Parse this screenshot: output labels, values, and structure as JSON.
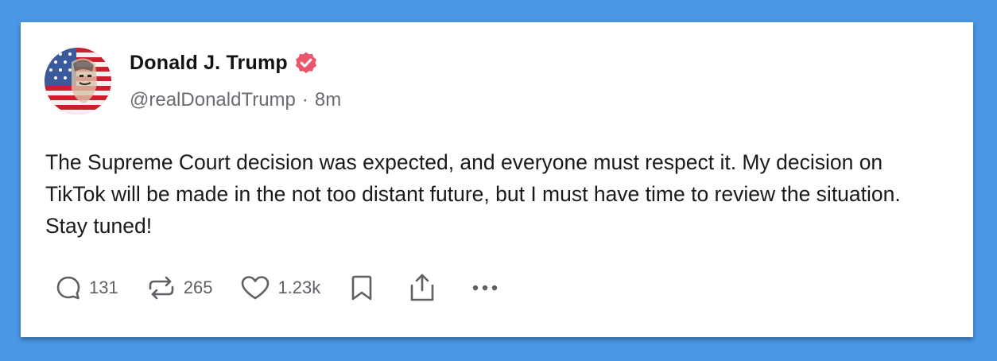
{
  "post": {
    "author_name": "Donald J. Trump",
    "handle": "@realDonaldTrump",
    "separator": "·",
    "time_ago": "8m",
    "text": "The Supreme Court decision was expected, and everyone must respect it. My decision on TikTok will be made in the not too distant future, but I must have time to review the situation. Stay tuned!"
  },
  "actions": {
    "reply_count": "131",
    "repost_count": "265",
    "like_count": "1.23k"
  },
  "icons": {
    "verified": "verified-badge-icon",
    "reply": "reply-bubble-icon",
    "repost": "repost-arrows-icon",
    "like": "heart-icon",
    "bookmark": "bookmark-icon",
    "share": "share-upload-icon",
    "more": "more-dots-icon"
  },
  "colors": {
    "background": "#4a97e6",
    "card": "#ffffff",
    "verified_badge": "#e9566e",
    "text_primary": "#1a1a1a",
    "text_secondary": "#6b6b72"
  }
}
